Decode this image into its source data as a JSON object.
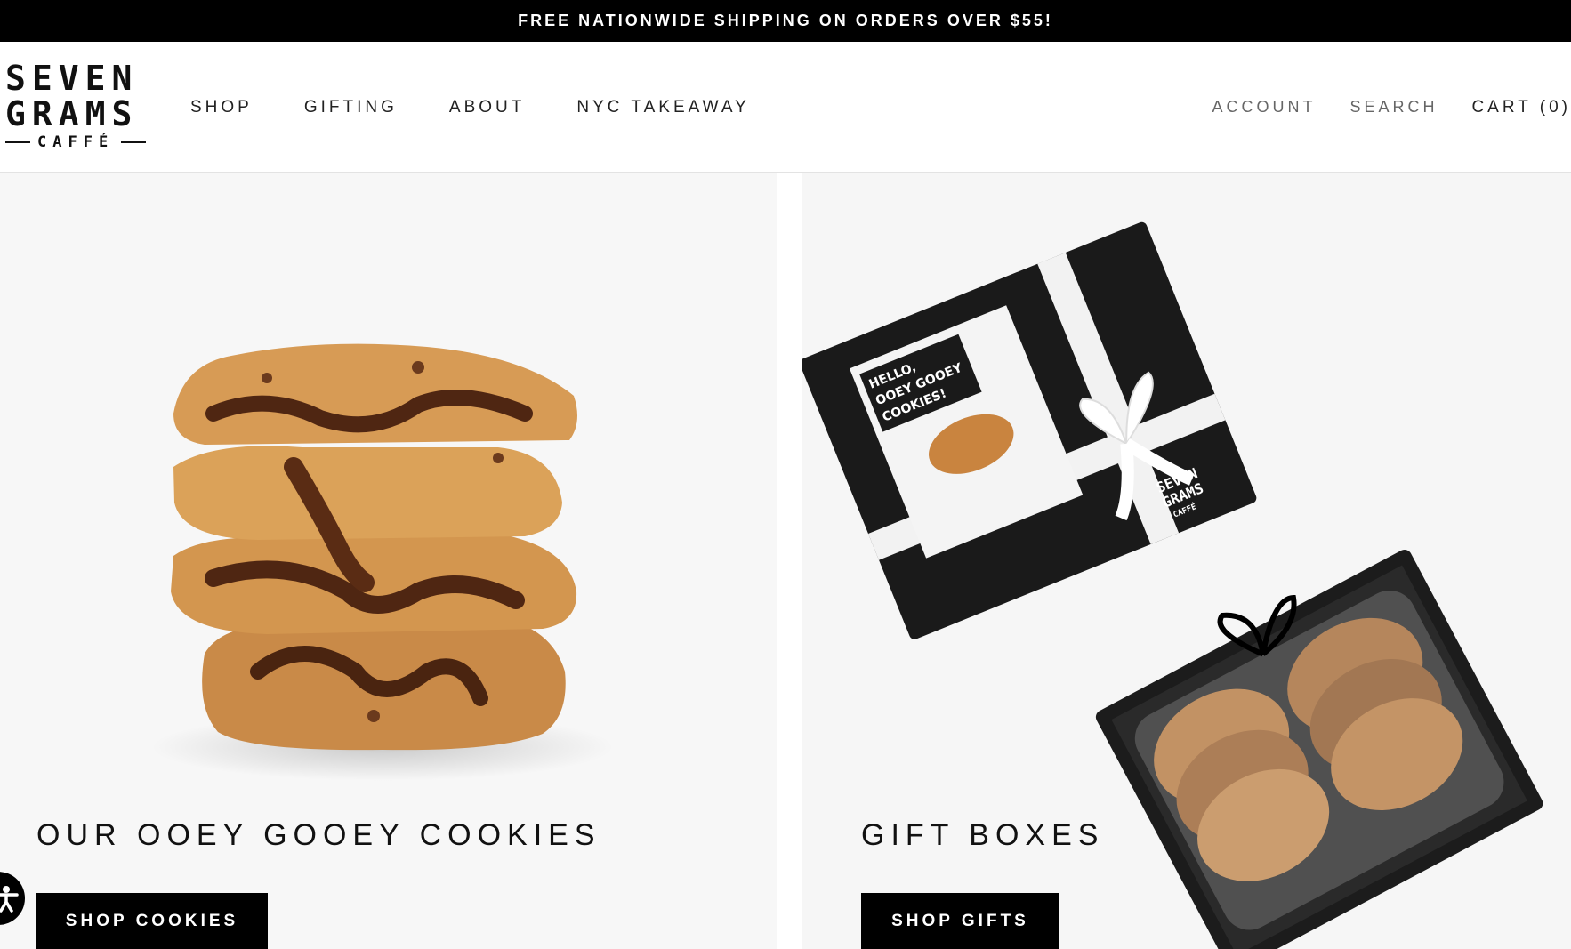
{
  "announcement": "FREE NATIONWIDE SHIPPING ON ORDERS OVER $55!",
  "logo": {
    "line1": "SEVEN",
    "line2": "GRAMS",
    "line3": "CAFFÉ"
  },
  "nav": [
    "SHOP",
    "GIFTING",
    "ABOUT",
    "NYC TAKEAWAY"
  ],
  "account_nav": {
    "account": "ACCOUNT",
    "search": "SEARCH",
    "cart": "CART (0)"
  },
  "panels": [
    {
      "title": "OUR OOEY GOOEY COOKIES",
      "button": "SHOP COOKIES",
      "image": "stacked-cookies-image"
    },
    {
      "title": "GIFT BOXES",
      "button": "SHOP GIFTS",
      "image": "gift-box-image",
      "box_card_text": [
        "HELLO,",
        "OOEY GOOEY",
        "COOKIES!"
      ],
      "box_lid_logo": [
        "SEVEN",
        "GRAMS",
        "CAFFÉ"
      ]
    }
  ],
  "colors": {
    "announcement_bg": "#000000",
    "button_bg": "#000000",
    "panel_bg": "#f7f7f7"
  },
  "icons": {
    "accessibility": "accessibility-icon"
  }
}
